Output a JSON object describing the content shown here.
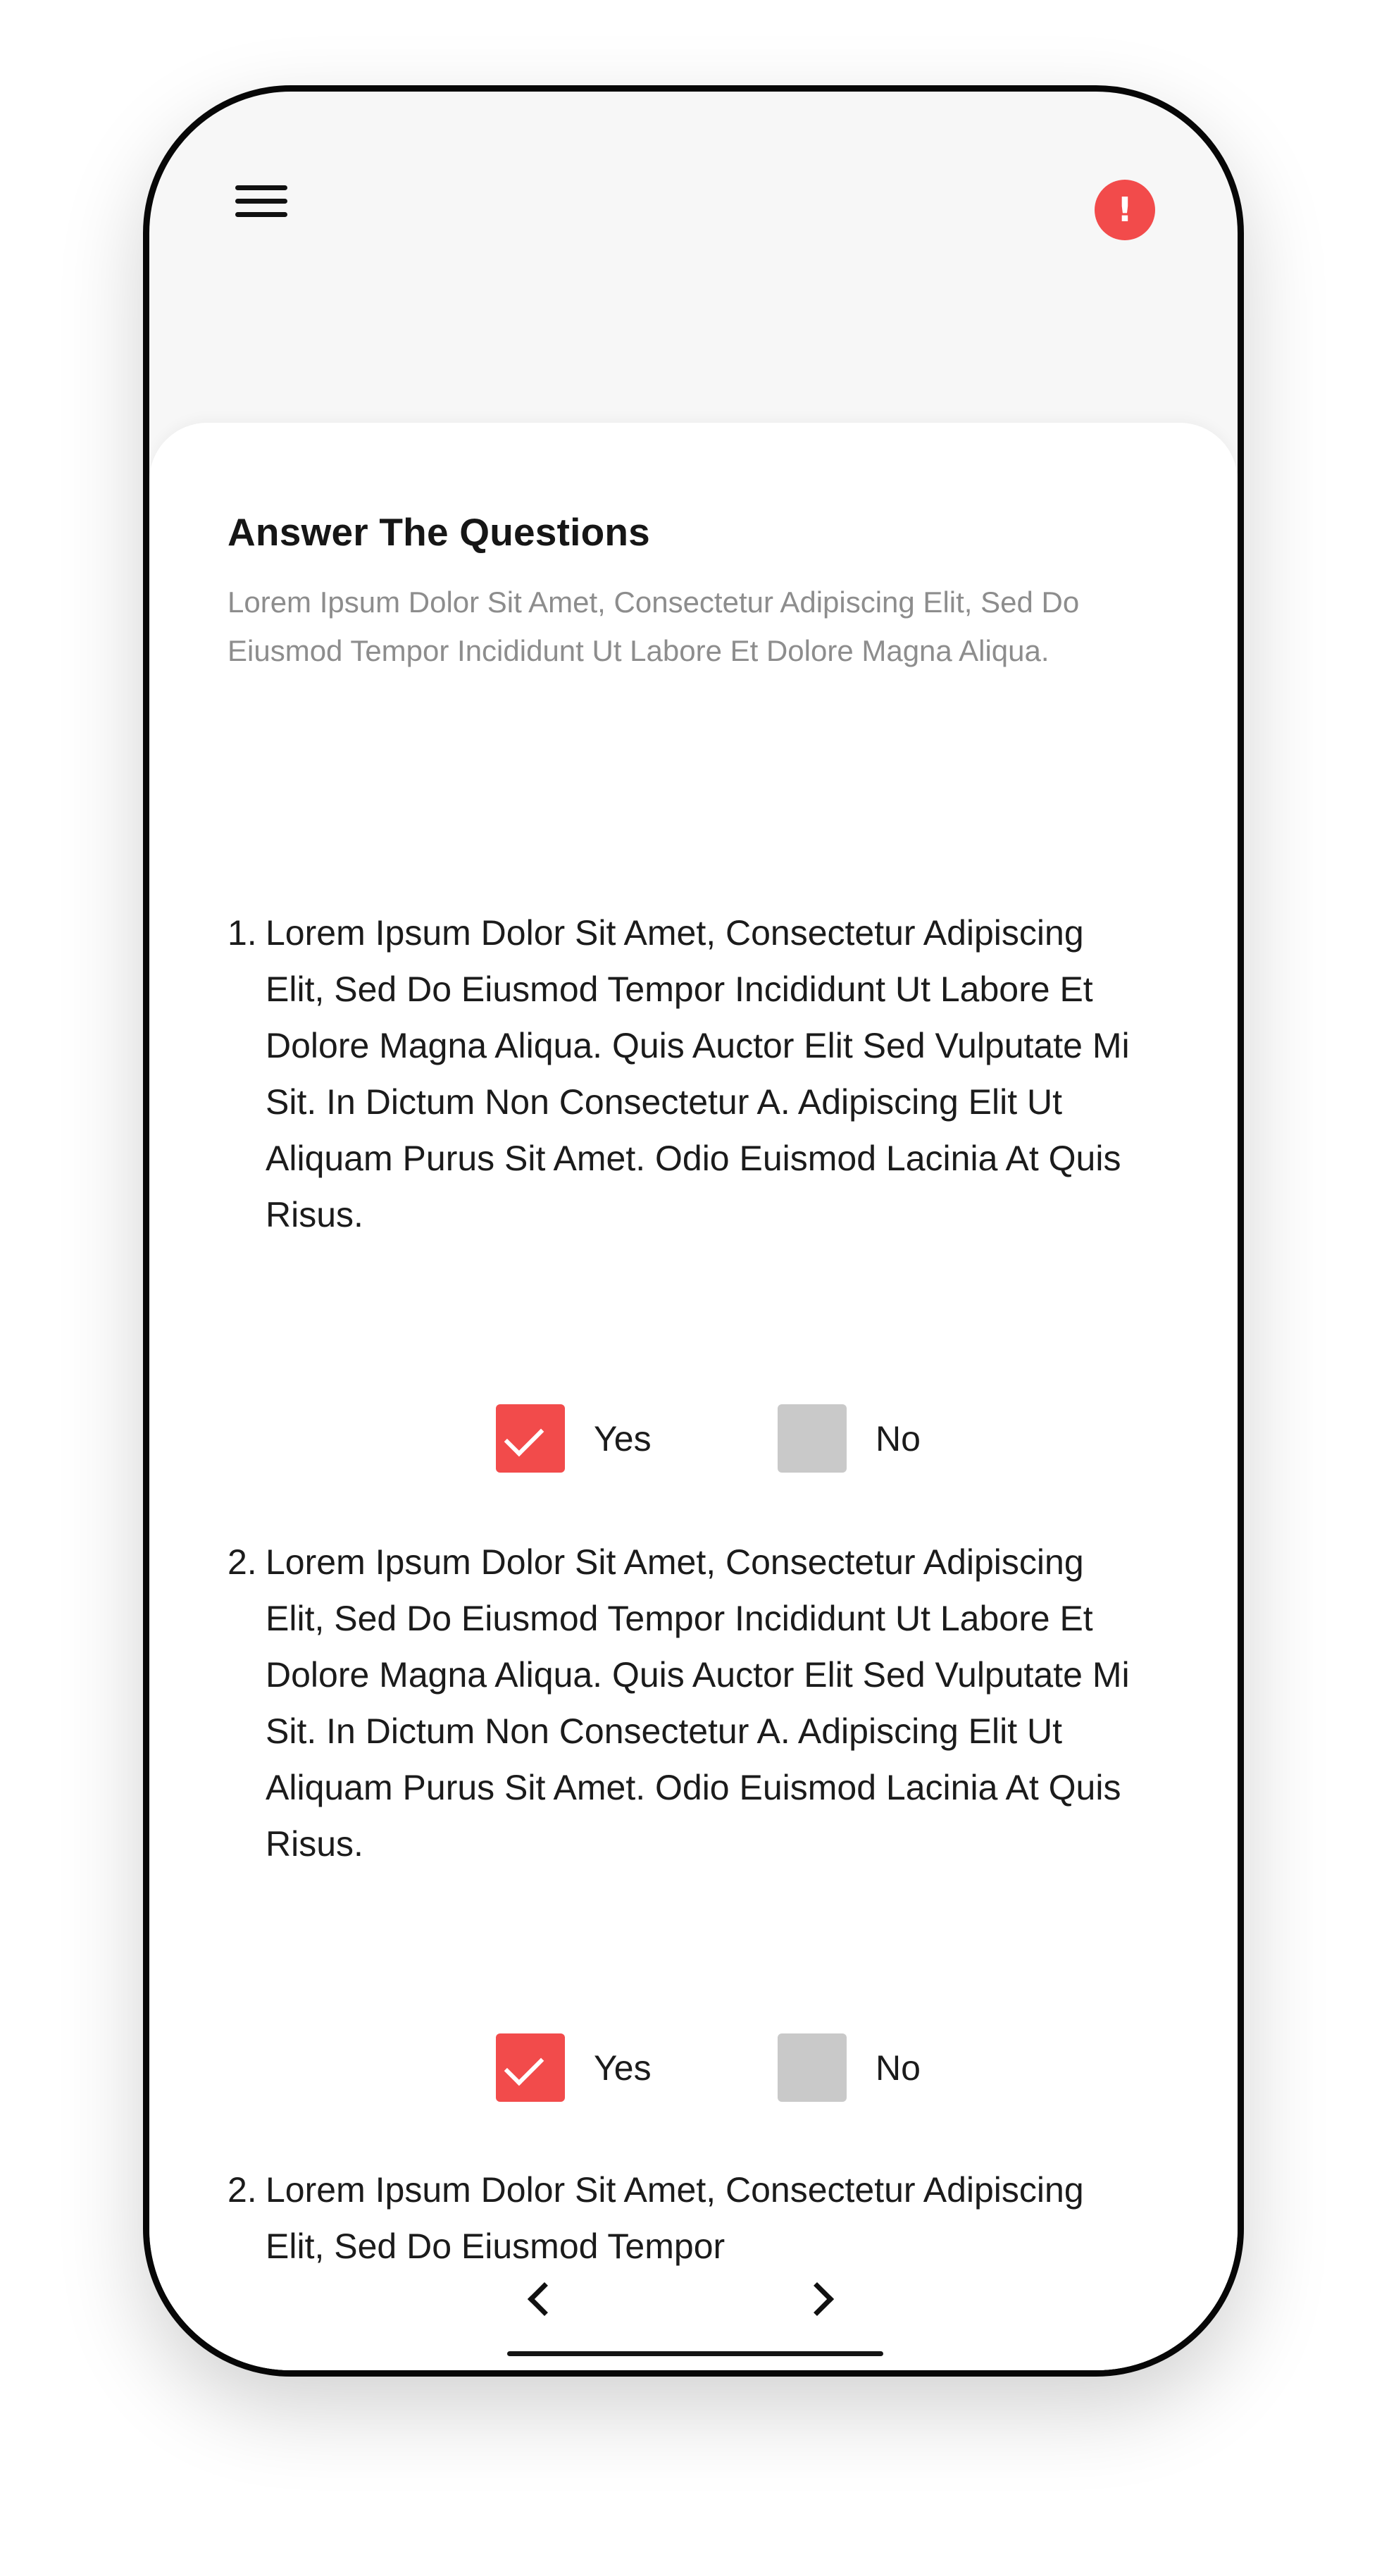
{
  "colors": {
    "accent": "#f24b4b",
    "background": "#f7f7f7",
    "card": "#ffffff",
    "unchecked": "#c9c9c9",
    "text": "#1b1b1b",
    "muted_text": "#8d8d8d"
  },
  "header": {
    "menu_icon": "menu-icon",
    "alert_icon": "alert-icon",
    "alert_symbol": "!"
  },
  "content": {
    "title": "Answer The Questions",
    "description": "Lorem Ipsum Dolor Sit Amet, Consectetur Adipiscing Elit, Sed Do Eiusmod Tempor Incididunt Ut Labore Et Dolore Magna Aliqua.",
    "questions": [
      {
        "number": "1.",
        "text": "Lorem Ipsum Dolor Sit Amet, Consectetur Adipiscing Elit, Sed Do Eiusmod Tempor Incididunt Ut Labore Et Dolore Magna Aliqua. Quis Auctor Elit Sed Vulputate Mi Sit. In Dictum Non Consectetur A. Adipiscing Elit Ut Aliquam Purus Sit Amet. Odio Euismod Lacinia At Quis Risus.",
        "yes_label": "Yes",
        "no_label": "No",
        "yes_checked": true,
        "no_checked": false
      },
      {
        "number": "2.",
        "text": "Lorem Ipsum Dolor Sit Amet, Consectetur Adipiscing Elit, Sed Do Eiusmod Tempor Incididunt Ut Labore Et Dolore Magna Aliqua. Quis Auctor Elit Sed Vulputate Mi Sit. In Dictum Non Consectetur A. Adipiscing Elit Ut Aliquam Purus Sit Amet. Odio Euismod Lacinia At Quis Risus.",
        "yes_label": "Yes",
        "no_label": "No",
        "yes_checked": true,
        "no_checked": false
      },
      {
        "number": "2.",
        "text": "Lorem Ipsum Dolor Sit Amet, Consectetur Adipiscing Elit, Sed Do Eiusmod Tempor"
      }
    ]
  },
  "navigation": {
    "prev_icon": "chevron-left-icon",
    "next_icon": "chevron-right-icon"
  }
}
